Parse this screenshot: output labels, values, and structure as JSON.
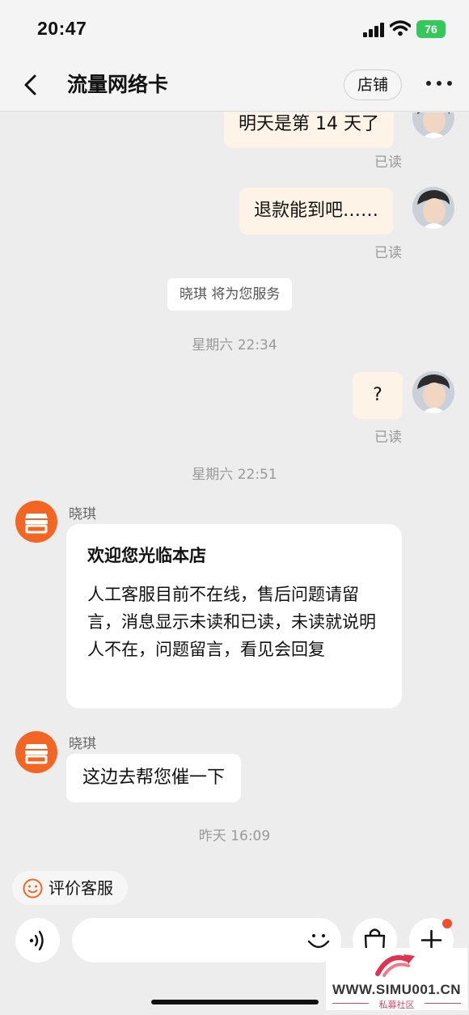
{
  "status_bar": {
    "time": "20:47",
    "battery": "76"
  },
  "header": {
    "title": "流量网络卡",
    "shop_button": "店铺"
  },
  "messages": {
    "out_1": {
      "text": "明天是第 14 天了",
      "status": "已读"
    },
    "out_2": {
      "text": "退款能到吧……",
      "status": "已读"
    },
    "system_notice": "晓琪 将为您服务",
    "timestamp_1": "星期六 22:34",
    "out_3": {
      "text": "?",
      "status": "已读"
    },
    "timestamp_2": "星期六 22:51",
    "in_1": {
      "sender": "晓琪",
      "title": "欢迎您光临本店",
      "body": "人工客服目前不在线，售后问题请留言，消息显示未读和已读，未读就说明人不在，问题留言，看见会回复"
    },
    "in_2": {
      "sender": "晓琪",
      "text": "这边去帮您催一下"
    },
    "timestamp_3": "昨天 16:09"
  },
  "bottom": {
    "rate_button": "评价客服",
    "input_placeholder": "",
    "icons": [
      "voice-icon",
      "emoji-icon",
      "shopping-bag-icon",
      "plus-icon"
    ]
  },
  "watermark": {
    "url": "WWW.SIMU001.CN",
    "subtitle": "私募社区"
  },
  "colors": {
    "accent": "#f26522",
    "out_bubble": "#fdf4e7",
    "battery": "#34c759",
    "background": "#ededed"
  }
}
